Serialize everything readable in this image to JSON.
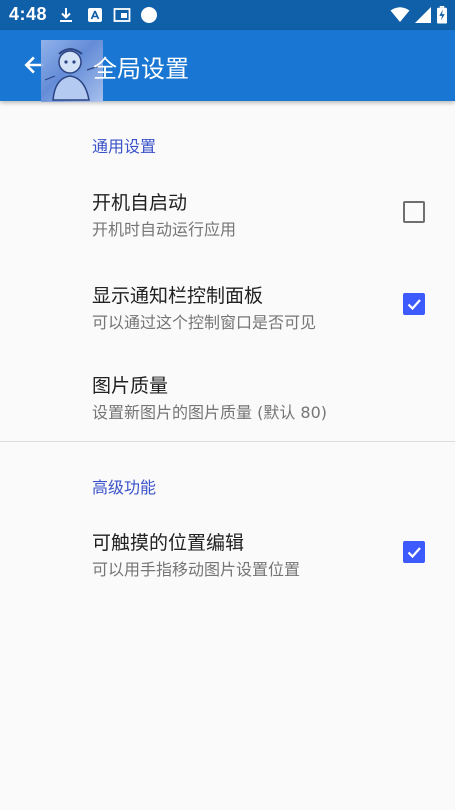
{
  "status_bar": {
    "time": "4:48",
    "icons": [
      "download-icon",
      "app-notification-icon",
      "screencast-icon",
      "circle-icon",
      "wifi-icon",
      "signal-icon",
      "battery-charging-icon"
    ]
  },
  "app_bar": {
    "title": "全局设置",
    "back_icon": "arrow-left-icon"
  },
  "sections": {
    "general": {
      "header": "通用设置",
      "items": [
        {
          "title": "开机自启动",
          "summary": "开机时自动运行应用",
          "checked": false
        },
        {
          "title": "显示通知栏控制面板",
          "summary": "可以通过这个控制窗口是否可见",
          "checked": true
        },
        {
          "title": "图片质量",
          "summary": "设置新图片的图片质量 (默认 80)"
        }
      ]
    },
    "advanced": {
      "header": "高级功能",
      "items": [
        {
          "title": "可触摸的位置编辑",
          "summary": "可以用手指移动图片设置位置",
          "checked": true
        }
      ]
    }
  },
  "colors": {
    "status_bar": "#0f5fa9",
    "app_bar": "#1976d2",
    "accent": "#3d5afe",
    "section_header": "#3a52c9"
  }
}
